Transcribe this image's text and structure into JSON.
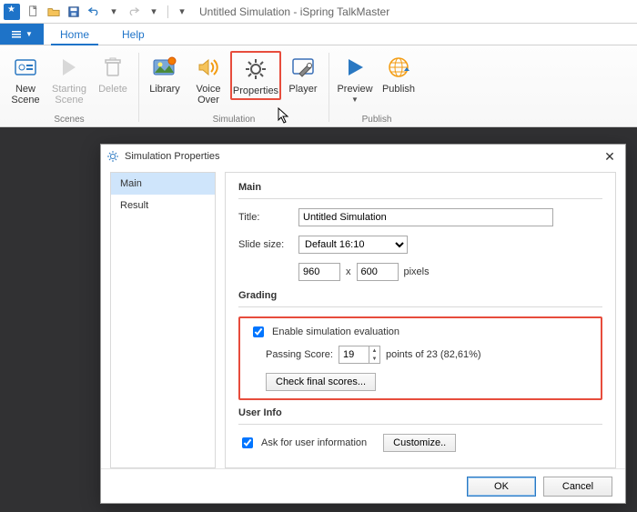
{
  "window": {
    "title": "Untitled Simulation - iSpring TalkMaster"
  },
  "tabs": {
    "home": "Home",
    "help": "Help"
  },
  "ribbon": {
    "scenes": {
      "new_scene": "New\nScene",
      "starting_scene": "Starting\nScene",
      "delete": "Delete",
      "group": "Scenes"
    },
    "simulation": {
      "library": "Library",
      "voice_over": "Voice\nOver",
      "properties": "Properties",
      "player": "Player",
      "group": "Simulation"
    },
    "publish": {
      "preview": "Preview",
      "publish": "Publish",
      "group": "Publish"
    }
  },
  "dialog": {
    "title": "Simulation Properties",
    "side": {
      "main": "Main",
      "result": "Result"
    },
    "main": {
      "header": "Main",
      "title_label": "Title:",
      "title_value": "Untitled Simulation",
      "slide_label": "Slide size:",
      "slide_value": "Default 16:10",
      "width": "960",
      "height": "600",
      "x": "x",
      "pixels": "pixels"
    },
    "grading": {
      "header": "Grading",
      "enable": "Enable simulation evaluation",
      "passing_label": "Passing Score:",
      "passing_value": "19",
      "points_text": "points of 23 (82,61%)",
      "check_scores": "Check final scores..."
    },
    "userinfo": {
      "header": "User Info",
      "ask": "Ask for user information",
      "customize": "Customize.."
    },
    "ok": "OK",
    "cancel": "Cancel"
  }
}
